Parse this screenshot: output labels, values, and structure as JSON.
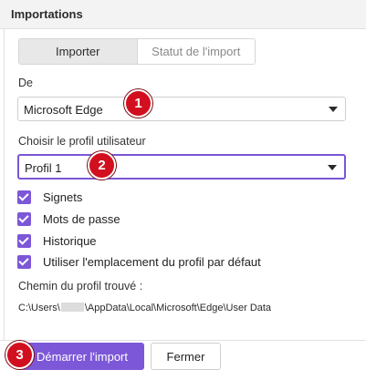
{
  "dialog": {
    "title": "Importations"
  },
  "tabs": [
    {
      "label": "Importer",
      "active": true
    },
    {
      "label": "Statut de l'import",
      "active": false
    }
  ],
  "source": {
    "label": "De",
    "value": "Microsoft Edge"
  },
  "profile": {
    "label": "Choisir le profil utilisateur",
    "value": "Profil 1"
  },
  "options": [
    {
      "label": "Signets",
      "checked": true
    },
    {
      "label": "Mots de passe",
      "checked": true
    },
    {
      "label": "Historique",
      "checked": true
    },
    {
      "label": "Utiliser l'emplacement du profil par défaut",
      "checked": true
    }
  ],
  "profile_path": {
    "label": "Chemin du profil trouvé :",
    "prefix": "C:\\Users\\",
    "suffix": "\\AppData\\Local\\Microsoft\\Edge\\User Data"
  },
  "buttons": {
    "start": "Démarrer l'import",
    "close": "Fermer"
  },
  "markers": [
    "1",
    "2",
    "3"
  ],
  "colors": {
    "accent": "#7c57d8",
    "marker": "#d20f1e"
  }
}
